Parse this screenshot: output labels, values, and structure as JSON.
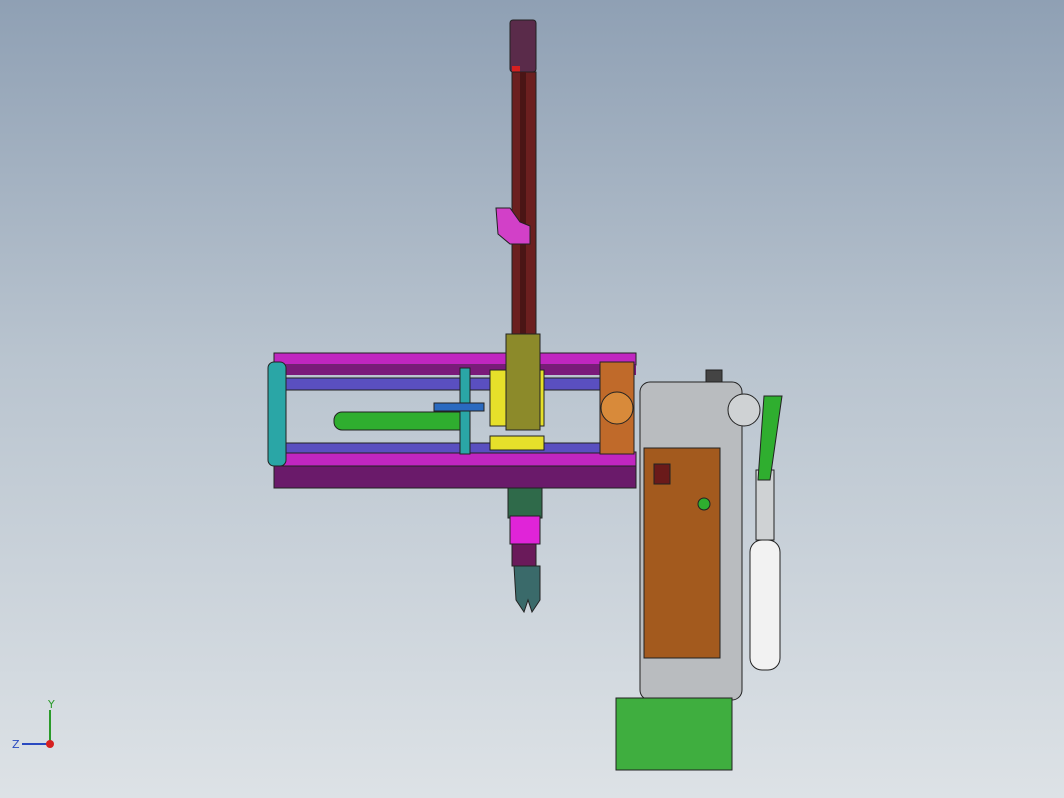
{
  "viewport": {
    "background_top": "#8fa0b4",
    "background_bottom": "#dde2e6"
  },
  "model": {
    "parts": [
      "vertical-arm",
      "arm-top-cap",
      "upper-clamp",
      "horizontal-frame",
      "guide-rod",
      "green-cylinder",
      "slider-carriage",
      "end-coupling",
      "gripper-head",
      "gripper-fingers",
      "base-column",
      "control-panel",
      "motor-housing",
      "base-foot",
      "side-pneumatic-cylinder",
      "linkage-arm"
    ],
    "colors": {
      "arm": "#6b1f1f",
      "frame": "#c026c0",
      "frame_dark": "#7a1a7a",
      "rod": "#5a4fc0",
      "cylinder": "#2fae2f",
      "carriage": "#e6e02a",
      "coupling": "#c06a2a",
      "column": "#b9bcbf",
      "panel": "#a35a1e",
      "foot": "#3fae3f",
      "teal": "#2aa6a6",
      "magenta": "#e024d8"
    }
  },
  "triad": {
    "y_label": "Y",
    "z_label": "Z",
    "icon": "coordinate-triad-icon"
  }
}
